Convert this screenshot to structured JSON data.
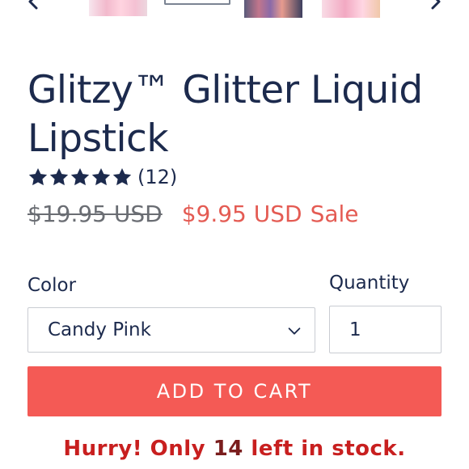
{
  "thumbnails": {
    "prev_icon": "chevron-left-icon",
    "next_icon": "chevron-right-icon",
    "count_visible": 4
  },
  "product": {
    "title": "Glitzy™ Glitter Liquid Lipstick",
    "rating": {
      "stars": 5,
      "count_text": "(12)"
    },
    "price": {
      "regular": "$19.95 USD",
      "sale": "$9.95 USD",
      "sale_label": "Sale"
    }
  },
  "options": {
    "color_label": "Color",
    "color_value": "Candy Pink",
    "quantity_label": "Quantity",
    "quantity_value": "1"
  },
  "actions": {
    "add_to_cart": "ADD TO CART"
  },
  "stock": {
    "prefix": "Hurry! Only ",
    "count": "14",
    "suffix": " left in stock."
  },
  "colors": {
    "primary_text": "#1c2a4d",
    "sale_red": "#e45b53",
    "button_bg": "#f45a55",
    "stock_red": "#c81f1f"
  }
}
